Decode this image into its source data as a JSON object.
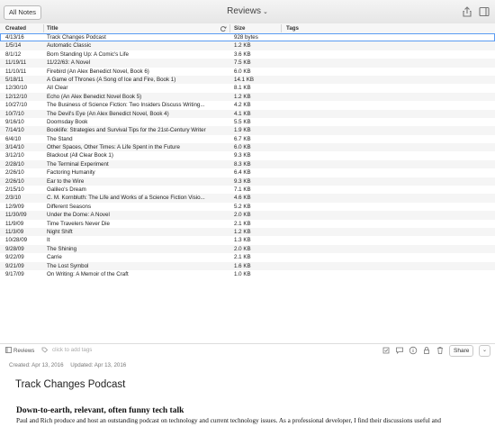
{
  "toolbar": {
    "all_notes_label": "All Notes",
    "notebook_title": "Reviews",
    "notebook_chevron": "⌄"
  },
  "table": {
    "columns": {
      "created": "Created",
      "title": "Title",
      "size": "Size",
      "tags": "Tags"
    },
    "sort_indicator": "⌄",
    "selected_row": 0,
    "rows": [
      {
        "created": "4/13/16",
        "title": "Track Changes Podcast",
        "size": "928 bytes"
      },
      {
        "created": "1/5/14",
        "title": "Automatic Classic",
        "size": "1.2 KB"
      },
      {
        "created": "8/1/12",
        "title": "Born Standing Up: A Comic's Life",
        "size": "3.6 KB"
      },
      {
        "created": "11/19/11",
        "title": "11/22/63: A Novel",
        "size": "7.5 KB"
      },
      {
        "created": "11/10/11",
        "title": "Firebird (An Alex Benedict Novel, Book 6)",
        "size": "6.0 KB"
      },
      {
        "created": "5/18/11",
        "title": "A Game of Thrones (A Song of Ice and Fire, Book 1)",
        "size": "14.1 KB"
      },
      {
        "created": "12/30/10",
        "title": "All Clear",
        "size": "8.1 KB"
      },
      {
        "created": "12/12/10",
        "title": "Echo (An Alex Benedict Novel Book 5)",
        "size": "1.2 KB"
      },
      {
        "created": "10/27/10",
        "title": "The Business of Science Fiction: Two Insiders Discuss Writing...",
        "size": "4.2 KB"
      },
      {
        "created": "10/7/10",
        "title": "The Devil's Eye (An Alex Benedict Novel, Book 4)",
        "size": "4.1 KB"
      },
      {
        "created": "9/16/10",
        "title": "Doomsday Book",
        "size": "5.5 KB"
      },
      {
        "created": "7/14/10",
        "title": "Booklife: Strategies and Survival Tips for the 21st-Century Writer",
        "size": "1.9 KB"
      },
      {
        "created": "6/4/10",
        "title": "The Stand",
        "size": "6.7 KB"
      },
      {
        "created": "3/14/10",
        "title": "Other Spaces, Other Times: A Life Spent in the Future",
        "size": "6.0 KB"
      },
      {
        "created": "3/12/10",
        "title": "Blackout (All Clear Book 1)",
        "size": "9.3 KB"
      },
      {
        "created": "2/28/10",
        "title": "The Terminal Experiment",
        "size": "8.3 KB"
      },
      {
        "created": "2/26/10",
        "title": "Factoring Humanity",
        "size": "6.4 KB"
      },
      {
        "created": "2/26/10",
        "title": "Ear to the Wire",
        "size": "9.3 KB"
      },
      {
        "created": "2/15/10",
        "title": "Galileo's Dream",
        "size": "7.1 KB"
      },
      {
        "created": "2/3/10",
        "title": "C. M. Kornbluth: The Life and Works of a Science Fiction Visio...",
        "size": "4.6 KB"
      },
      {
        "created": "12/9/09",
        "title": "Different Seasons",
        "size": "5.2 KB"
      },
      {
        "created": "11/30/09",
        "title": "Under the Dome: A Novel",
        "size": "2.0 KB"
      },
      {
        "created": "11/9/09",
        "title": "Time Travelers Never Die",
        "size": "2.1 KB"
      },
      {
        "created": "11/3/09",
        "title": "Night Shift",
        "size": "1.2 KB"
      },
      {
        "created": "10/28/09",
        "title": "It",
        "size": "1.3 KB"
      },
      {
        "created": "9/28/09",
        "title": "The Shining",
        "size": "2.0 KB"
      },
      {
        "created": "9/22/09",
        "title": "Carrie",
        "size": "2.1 KB"
      },
      {
        "created": "9/21/09",
        "title": "The Lost Symbol",
        "size": "1.6 KB"
      },
      {
        "created": "9/17/09",
        "title": "On Writing: A Memoir of the Craft",
        "size": "1.0 KB"
      }
    ]
  },
  "note_bar": {
    "notebook_label": "Reviews",
    "tags_placeholder": "click to add tags",
    "share_label": "Share",
    "share_arrow": "⌄"
  },
  "note": {
    "created": "Created: Apr 13, 2016",
    "updated": "Updated: Apr 13, 2016",
    "title": "Track Changes Podcast",
    "heading": "Down-to-earth, relevant, often funny tech talk",
    "body": "Paul and Rich produce and host an outstanding podcast on technology and current technology issues. As a professional developer, I find their discussions useful and"
  },
  "colors": {
    "selection": "#5b9cf2",
    "toolbar": "#ececec"
  }
}
